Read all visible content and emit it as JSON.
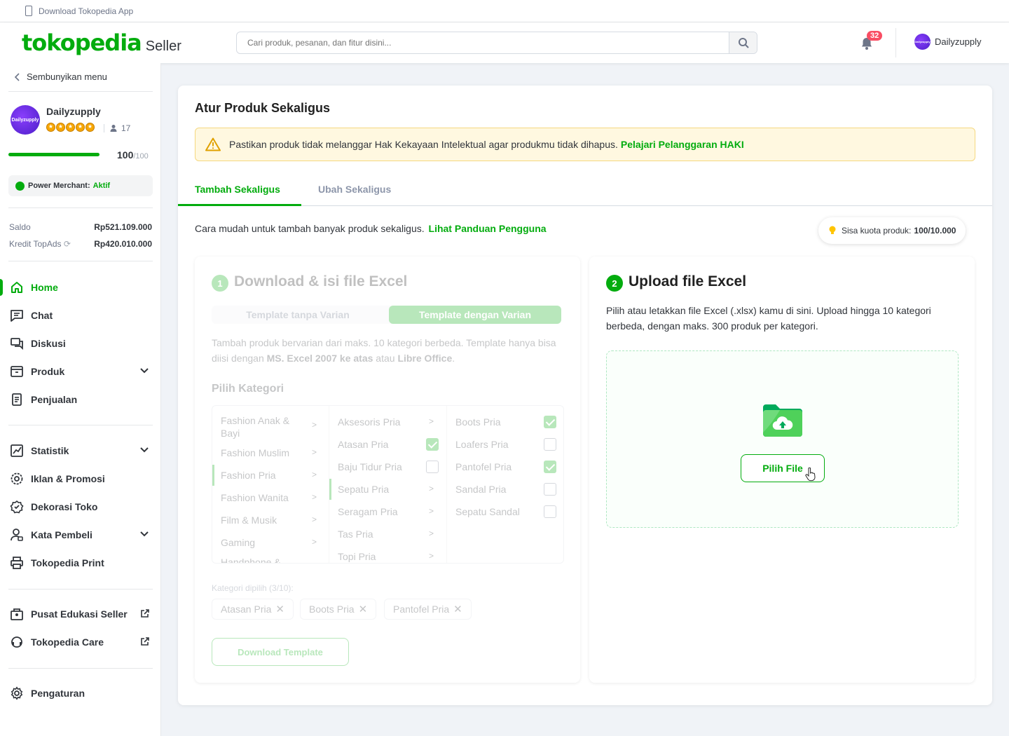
{
  "topbar": {
    "download_app": "Download Tokopedia App"
  },
  "header": {
    "brand": "tokopedia",
    "seller": "Seller",
    "search_placeholder": "Cari produk, pesanan, dan fitur disini...",
    "notif_count": "32",
    "shop_name": "Dailyzupply",
    "avatar_text": "Dailyzupply"
  },
  "sidebar": {
    "hide_menu": "Sembunyikan menu",
    "shop_name": "Dailyzupply",
    "avatar_text": "Dailyzupply",
    "followers": "17",
    "score": "100",
    "score_max": "/100",
    "score_fraction": 1.0,
    "power_merchant_label": "Power Merchant:",
    "power_merchant_status": "Aktif",
    "saldo_label": "Saldo",
    "saldo_value": "Rp521.109.000",
    "topads_label": "Kredit TopAds",
    "topads_value": "Rp420.010.000",
    "nav": {
      "home": "Home",
      "chat": "Chat",
      "diskusi": "Diskusi",
      "produk": "Produk",
      "penjualan": "Penjualan",
      "statistik": "Statistik",
      "iklan": "Iklan & Promosi",
      "dekorasi": "Dekorasi Toko",
      "kata_pembeli": "Kata Pembeli",
      "print": "Tokopedia Print",
      "edukasi": "Pusat Edukasi Seller",
      "care": "Tokopedia Care",
      "pengaturan": "Pengaturan"
    }
  },
  "main": {
    "title": "Atur Produk Sekaligus",
    "warning_text": "Pastikan produk tidak melanggar Hak Kekayaan Intelektual agar produkmu tidak dihapus.",
    "warning_link": "Pelajari Pelanggaran HAKI",
    "tabs": {
      "tambah": "Tambah Sekaligus",
      "ubah": "Ubah Sekaligus"
    },
    "intro_text": "Cara mudah untuk tambah banyak produk sekaligus.",
    "intro_link": "Lihat Panduan Pengguna",
    "quota_label": "Sisa kuota produk:",
    "quota_value": "100/10.000",
    "step1": {
      "num": "1",
      "title": "Download & isi file Excel",
      "opt_off": "Template tanpa Varian",
      "opt_on": "Template dengan Varian",
      "desc_a": "Tambah produk bervarian dari maks. 10 kategori berbeda. Template hanya bisa diisi dengan",
      "desc_b": "MS. Excel 2007 ke atas",
      "desc_c": "atau",
      "desc_d": "Libre Office",
      "desc_e": ".",
      "kategori_title": "Pilih Kategori",
      "col1": [
        "Fashion Anak & Bayi",
        "Fashion Muslim",
        "Fashion Pria",
        "Fashion Wanita",
        "Film & Musik",
        "Gaming",
        "Handphone &"
      ],
      "col2": [
        "Aksesoris Pria",
        "Atasan Pria",
        "Baju Tidur Pria",
        "Sepatu Pria",
        "Seragam Pria",
        "Tas Pria",
        "Topi Pria"
      ],
      "col3": [
        "Boots Pria",
        "Loafers Pria",
        "Pantofel Pria",
        "Sandal Pria",
        "Sepatu Sandal"
      ],
      "chosen_label": "Kategori dipilih (3/10):",
      "chips": [
        "Atasan Pria",
        "Boots Pria",
        "Pantofel Pria"
      ],
      "download_btn": "Download Template"
    },
    "step2": {
      "num": "2",
      "title": "Upload file Excel",
      "desc": "Pilih atau letakkan file Excel (.xlsx) kamu di sini. Upload hingga 10 kategori berbeda, dengan maks. 300 produk per kategori.",
      "pick_btn": "Pilih File"
    }
  },
  "colors": {
    "brand": "#03ac0e",
    "warning_bg": "#fff8e0",
    "badge": "#f94d63"
  }
}
